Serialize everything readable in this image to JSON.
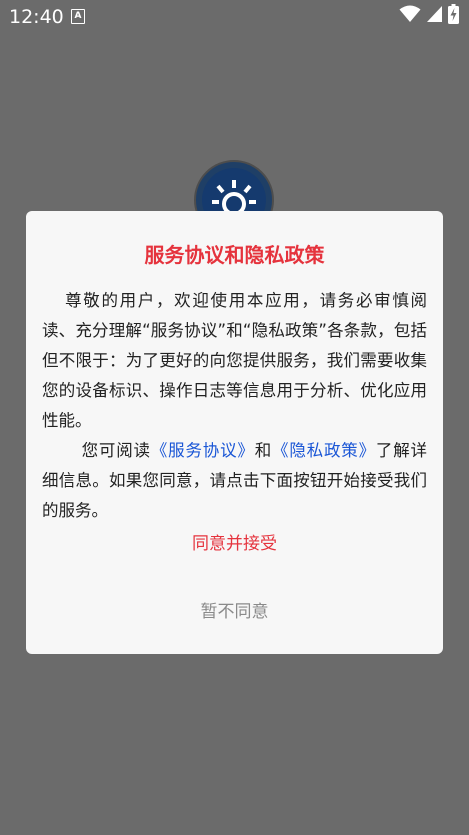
{
  "status_bar": {
    "time": "12:40",
    "notification_icon_letter": "A",
    "icons": [
      "wifi-icon",
      "signal-icon",
      "battery-charging-icon"
    ]
  },
  "dialog": {
    "title": "服务协议和隐私政策",
    "paragraph1": "尊敬的用户，欢迎使用本应用，请务必审慎阅读、充分理解“服务协议”和“隐私政策”各条款，包括但不限于：为了更好的向您提供服务，我们需要收集您的设备标识、操作日志等信息用于分析、优化应用性能。",
    "paragraph2_prefix": "您可阅读",
    "link_service": "《服务协议》",
    "paragraph2_and": "和",
    "link_privacy": "《隐私政策》",
    "paragraph2_suffix": "了解详细信息。如果您同意，请点击下面按钮开始接受我们的服务。",
    "accept_label": "同意并接受",
    "decline_label": "暂不同意"
  },
  "colors": {
    "overlay": "#6b6b6b",
    "title": "#e5333d",
    "link": "#1a56d6",
    "decline": "#8a8a8a"
  }
}
